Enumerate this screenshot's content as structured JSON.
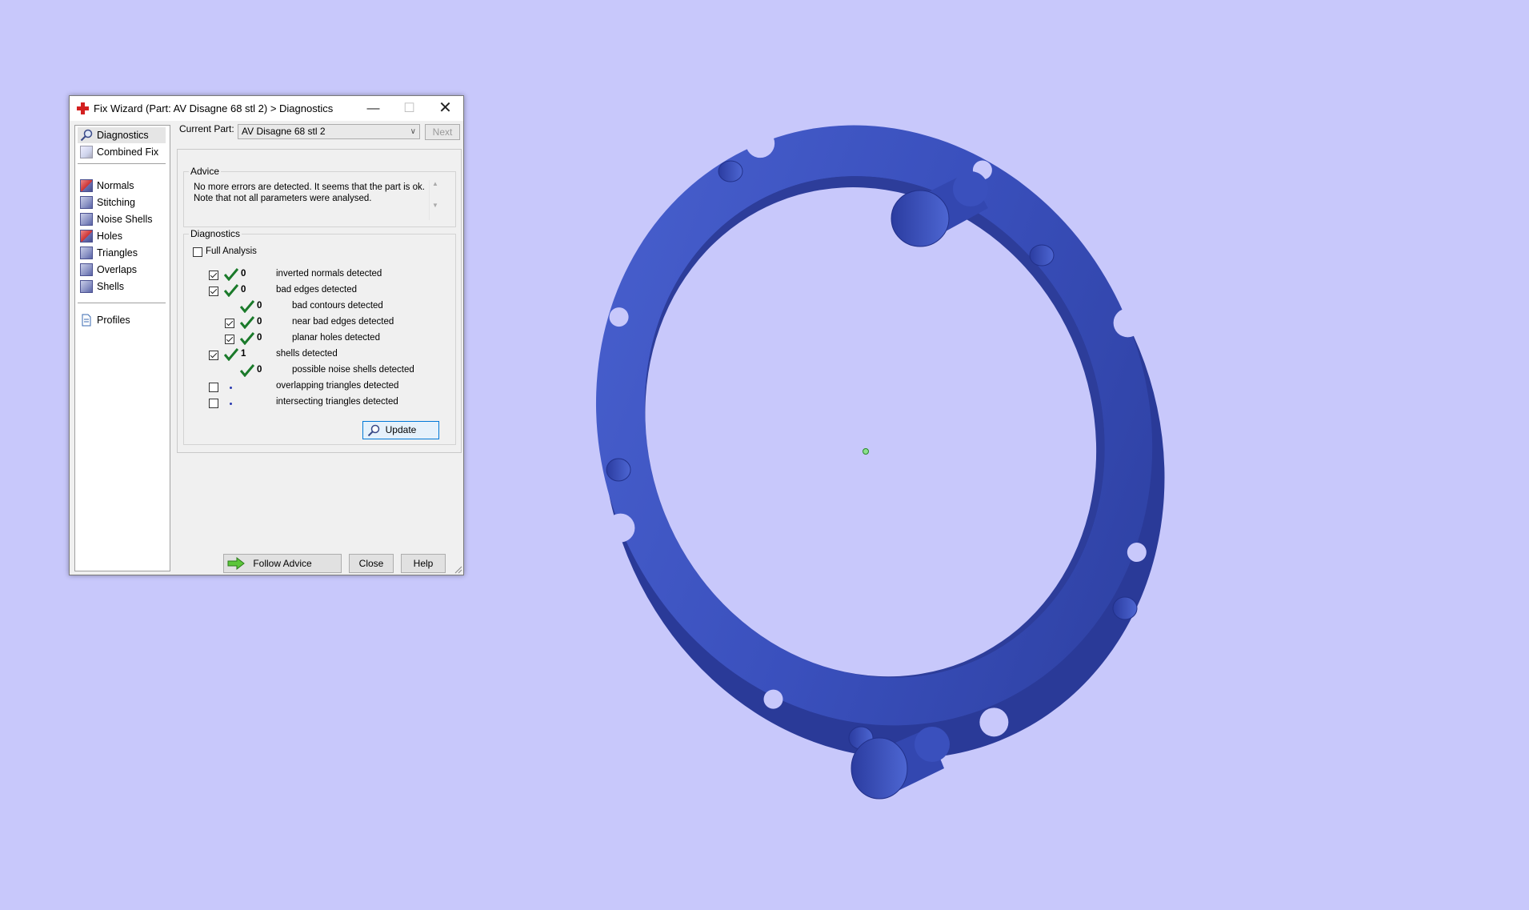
{
  "window": {
    "title": "Fix Wizard (Part: AV Disagne 68 stl 2) > Diagnostics",
    "title_icon": "red-cross-icon",
    "controls": [
      "minimize",
      "maximize",
      "close"
    ]
  },
  "nav": {
    "items": [
      {
        "label": "Diagnostics",
        "icon": "magnifier-icon",
        "selected": true
      },
      {
        "label": "Combined Fix",
        "icon": "cube-icon"
      },
      {
        "label": "Normals",
        "icon": "normals-cube-icon"
      },
      {
        "label": "Stitching",
        "icon": "stitching-cube-icon"
      },
      {
        "label": "Noise Shells",
        "icon": "noise-shells-icon"
      },
      {
        "label": "Holes",
        "icon": "holes-cube-icon"
      },
      {
        "label": "Triangles",
        "icon": "triangles-cube-icon"
      },
      {
        "label": "Overlaps",
        "icon": "overlaps-cube-icon"
      },
      {
        "label": "Shells",
        "icon": "shells-cube-icon"
      },
      {
        "label": "Profiles",
        "icon": "document-icon"
      }
    ]
  },
  "current_part": {
    "label": "Current Part:",
    "value": "AV Disagne 68 stl 2",
    "next_label": "Next"
  },
  "advice": {
    "title": "Advice",
    "text": "No more errors are detected. It seems that the part is ok. Note that not all parameters were analysed."
  },
  "diagnostics": {
    "title": "Diagnostics",
    "full_analysis_label": "Full Analysis",
    "full_analysis_checked": false,
    "rows": [
      {
        "count": "0",
        "label": "inverted normals detected",
        "checked": true,
        "status": "ok"
      },
      {
        "count": "0",
        "label": "bad edges detected",
        "checked": true,
        "status": "ok"
      },
      {
        "count": "0",
        "label": "bad contours detected",
        "status": "ok"
      },
      {
        "count": "0",
        "label": "near bad edges detected",
        "checked": true,
        "status": "ok"
      },
      {
        "count": "0",
        "label": "planar holes detected",
        "checked": true,
        "status": "ok"
      },
      {
        "count": "1",
        "label": "shells detected",
        "checked": true,
        "status": "ok"
      },
      {
        "count": "0",
        "label": "possible noise shells detected",
        "status": "ok"
      },
      {
        "label": "overlapping triangles detected",
        "checked": false,
        "status": "not-analysed"
      },
      {
        "label": "intersecting triangles detected",
        "checked": false,
        "status": "not-analysed"
      }
    ],
    "update_label": "Update"
  },
  "buttons": {
    "follow_advice": "Follow Advice",
    "close": "Close",
    "help": "Help"
  },
  "colors": {
    "viewport_background": "#c8c8fb",
    "part_color": "#3a4fb8",
    "ok_tick": "#1a7a2a"
  }
}
